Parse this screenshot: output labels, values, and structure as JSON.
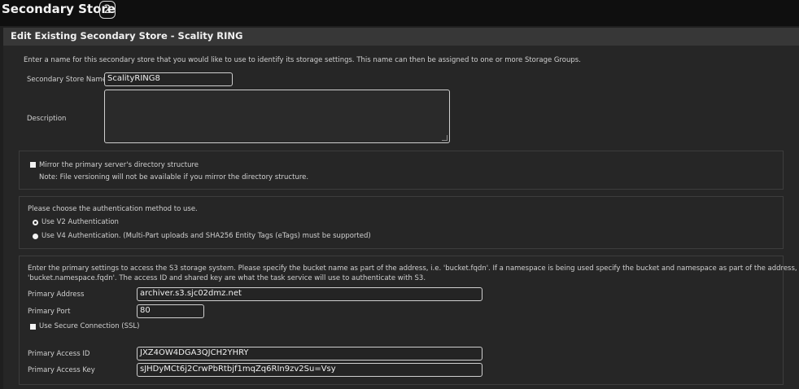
{
  "header": {
    "title": "Secondary Store",
    "badge": "2"
  },
  "panel": {
    "title": "Edit Existing Secondary Store - Scality RING",
    "intro": "Enter a name for this secondary store that you would like to use to identify its storage settings. This name can then be assigned to one or more Storage Groups."
  },
  "name_field": {
    "label": "Secondary Store Name",
    "value": "ScalityRING8"
  },
  "description_field": {
    "label": "Description",
    "value": ""
  },
  "mirror": {
    "label": "Mirror the primary server's directory structure",
    "note": "Note: File versioning will not be available if you mirror the directory structure.",
    "checked": false
  },
  "auth": {
    "prompt": "Please choose the authentication method to use.",
    "options": [
      {
        "label": "Use V2 Authentication",
        "selected": true
      },
      {
        "label": "Use V4 Authentication. (Multi-Part uploads and SHA256 Entity Tags (eTags) must be supported)",
        "selected": false
      }
    ]
  },
  "s3": {
    "intro_line1": "Enter the primary settings to access the S3 storage system. Please specify the bucket name as part of the address, i.e. 'bucket.fqdn'. If a namespace is being used specify the bucket and namespace as part of the address, i.e.",
    "intro_line2": "'bucket.namespace.fqdn'. The access ID and shared key are what the task service will use to authenticate with S3.",
    "address_label": "Primary Address",
    "address_value": "archiver.s3.sjc02dmz.net",
    "port_label": "Primary Port",
    "port_value": "80",
    "ssl_label": "Use Secure Connection (SSL)",
    "ssl_checked": false,
    "access_id_label": "Primary Access ID",
    "access_id_value": "JXZ4OW4DGA3QJCH2YHRY",
    "access_key_label": "Primary Access Key",
    "access_key_value": "sJHDyMCt6j2CrwPbRtbjf1mqZq6RIn9zv2Su=Vsy"
  }
}
